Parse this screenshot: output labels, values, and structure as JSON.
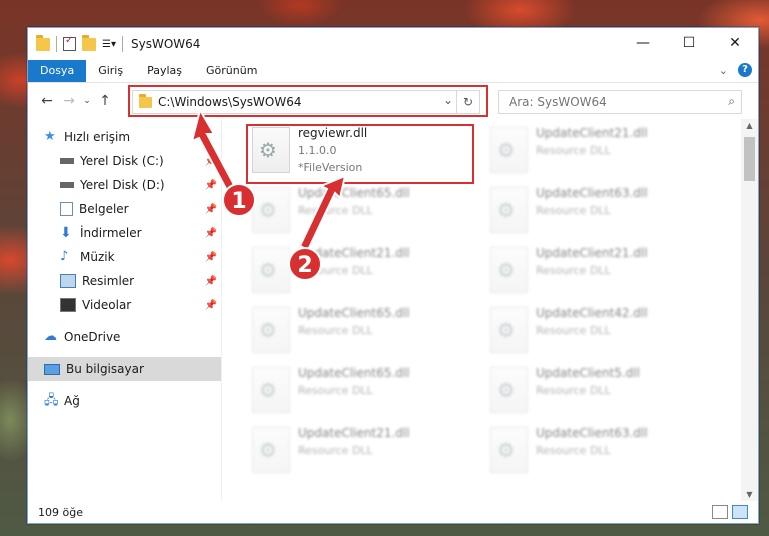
{
  "window": {
    "title": "SysWOW64",
    "controls": {
      "minimize": "—",
      "maximize": "☐",
      "close": "✕"
    }
  },
  "ribbon": {
    "tabs": [
      {
        "label": "Dosya",
        "active": true
      },
      {
        "label": "Giriş"
      },
      {
        "label": "Paylaş"
      },
      {
        "label": "Görünüm"
      }
    ],
    "help": "?"
  },
  "address": {
    "path": "C:\\Windows\\SysWOW64",
    "refresh": "↻",
    "dropdown": "⌄"
  },
  "search": {
    "placeholder": "Ara: SysWOW64"
  },
  "nav": {
    "quick_access": "Hızlı erişim",
    "items": [
      {
        "label": "Yerel Disk (C:)",
        "icon": "drive-icon"
      },
      {
        "label": "Yerel Disk (D:)",
        "icon": "drive-icon"
      },
      {
        "label": "Belgeler",
        "icon": "documents-icon"
      },
      {
        "label": "İndirmeler",
        "icon": "downloads-icon"
      },
      {
        "label": "Müzik",
        "icon": "music-icon"
      },
      {
        "label": "Resimler",
        "icon": "pictures-icon"
      },
      {
        "label": "Videolar",
        "icon": "videos-icon"
      }
    ],
    "onedrive": "OneDrive",
    "this_pc": "Bu bilgisayar",
    "network": "Ağ"
  },
  "files": {
    "highlighted": {
      "name": "regviewr.dll",
      "version": "1.1.0.0",
      "desc": "*FileVersion"
    },
    "others": [
      {
        "name": "UpdateClient21.dll",
        "desc": "Resource DLL"
      },
      {
        "name": "UpdateClient65.dll",
        "desc": "Resource DLL"
      },
      {
        "name": "UpdateClient63.dll",
        "desc": "Resource DLL"
      },
      {
        "name": "UpdateClient21.dll",
        "desc": "Resource DLL"
      },
      {
        "name": "UpdateClient21.dll",
        "desc": "Resource DLL"
      },
      {
        "name": "UpdateClient65.dll",
        "desc": "Resource DLL"
      },
      {
        "name": "UpdateClient42.dll",
        "desc": "Resource DLL"
      },
      {
        "name": "UpdateClient65.dll",
        "desc": "Resource DLL"
      },
      {
        "name": "UpdateClient5.dll",
        "desc": "Resource DLL"
      },
      {
        "name": "UpdateClient21.dll",
        "desc": "Resource DLL"
      },
      {
        "name": "UpdateClient63.dll",
        "desc": "Resource DLL"
      }
    ]
  },
  "status": {
    "count": "109 öğe"
  },
  "badges": {
    "one": "1",
    "two": "2"
  },
  "colors": {
    "accent": "#1979ca",
    "highlight": "#d83030"
  }
}
